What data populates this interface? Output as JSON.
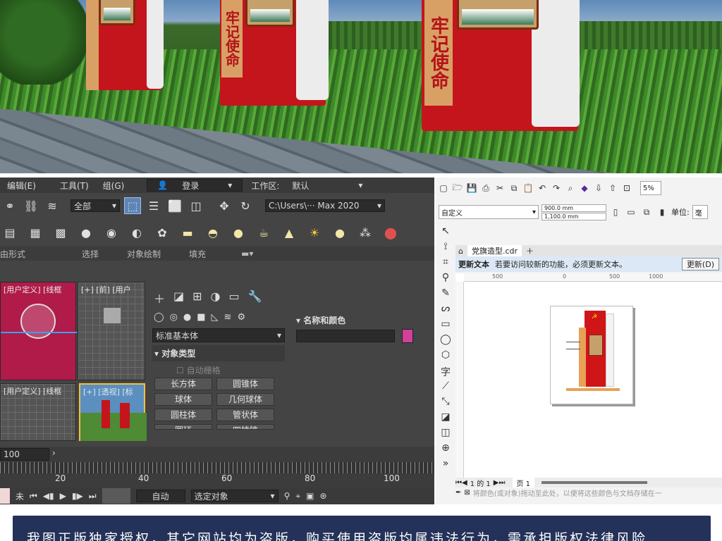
{
  "scene": {
    "sign_slogan_1": "牢记使命",
    "sign_slogan_2": "牢记使命",
    "sign_slogan_3": "牢记使命"
  },
  "max": {
    "menu": [
      "编辑(E)",
      "工具(T)",
      "组(G)"
    ],
    "login_label": "登录",
    "workspace_label": "工作区:",
    "workspace_value": "默认",
    "selection_filter": "全部",
    "path_field": "C:\\Users\\··· Max 2020",
    "ribbon": [
      "由形式",
      "选择",
      "对象绘制",
      "填充"
    ],
    "viewports": {
      "top_left": "[用户定义] [线框",
      "top_right": "[+] [前] [用户",
      "bottom_left": "[用户定义] [线框",
      "bottom_right": "[+] [透视] [标"
    },
    "command_panel": {
      "category": "标准基本体",
      "section_title": "对象类型",
      "autogrid": "自动栅格",
      "objects": [
        "长方体",
        "圆锥体",
        "球体",
        "几何球体",
        "圆柱体",
        "管状体",
        "圆环",
        "四棱锥"
      ],
      "name_color_title": "名称和颜色",
      "object_color": "#d3409a"
    },
    "frame_counter": "100",
    "ruler_numbers": [
      "20",
      "40",
      "60",
      "80",
      "100"
    ],
    "playback": {
      "key_mode": "自动",
      "key_filter": "选定对象",
      "unset_label": "未"
    }
  },
  "corel": {
    "preset": "自定义",
    "width": "900.0 mm",
    "height": "1,100.0 mm",
    "units_label": "单位:",
    "units_value": "毫",
    "zoom": "5%",
    "doc_tab": "党旗造型.cdr",
    "notification_title": "更新文本",
    "notification_text": "若要访问较新的功能，必须更新文本。",
    "notification_button": "更新(D)",
    "ruler_marks": [
      "500",
      "0",
      "500",
      "1000"
    ],
    "page_nav": "1 的 1",
    "page_tab": "页 1",
    "status_hint": "将颜色(或对象)拖动至此处，以便将这些颜色与文档存储在一",
    "accent_red": "#cf1518"
  },
  "notice": {
    "text": "我图正版独家授权，其它网站均为盗版，购买使用盗版均属违法行为，需承担版权法律风险"
  }
}
